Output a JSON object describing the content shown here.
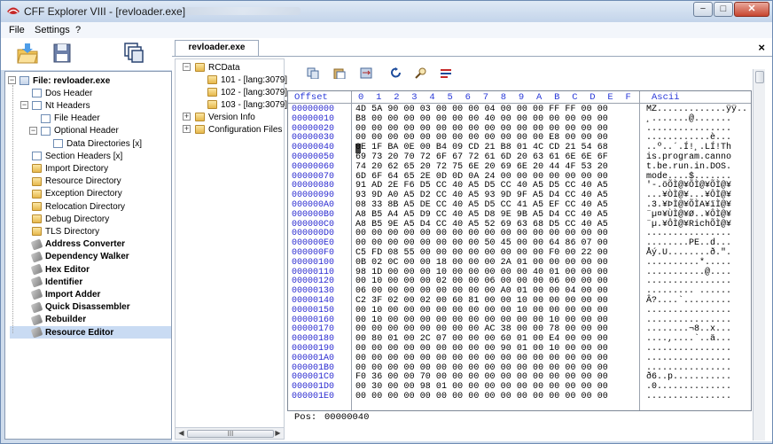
{
  "window": {
    "title": "CFF Explorer VIII - [revloader.exe]",
    "buttons": {
      "minimize": "−",
      "maximize": "□",
      "close": "✕"
    }
  },
  "menu": [
    "File",
    "Settings",
    "?"
  ],
  "left_tree": [
    {
      "label": "File: revloader.exe",
      "bold": true,
      "icon": "doc2",
      "level": 0,
      "expander": "−"
    },
    {
      "label": "Dos Header",
      "icon": "doc",
      "level": 1
    },
    {
      "label": "Nt Headers",
      "icon": "doc",
      "level": 1,
      "expander": "−"
    },
    {
      "label": "File Header",
      "icon": "doc",
      "level": 2
    },
    {
      "label": "Optional Header",
      "icon": "doc",
      "level": 2,
      "expander": "−"
    },
    {
      "label": "Data Directories [x]",
      "icon": "doc",
      "level": 3
    },
    {
      "label": "Section Headers [x]",
      "icon": "doc",
      "level": 1
    },
    {
      "label": "Import Directory",
      "icon": "folder",
      "level": 1
    },
    {
      "label": "Resource Directory",
      "icon": "folder",
      "level": 1
    },
    {
      "label": "Exception Directory",
      "icon": "folder",
      "level": 1
    },
    {
      "label": "Relocation Directory",
      "icon": "folder",
      "level": 1
    },
    {
      "label": "Debug Directory",
      "icon": "folder",
      "level": 1
    },
    {
      "label": "TLS Directory",
      "icon": "folder",
      "level": 1
    },
    {
      "label": "Address Converter",
      "bold": true,
      "icon": "tool",
      "level": 1
    },
    {
      "label": "Dependency Walker",
      "bold": true,
      "icon": "tool",
      "level": 1
    },
    {
      "label": "Hex Editor",
      "bold": true,
      "icon": "tool",
      "level": 1
    },
    {
      "label": "Identifier",
      "bold": true,
      "icon": "tool",
      "level": 1
    },
    {
      "label": "Import Adder",
      "bold": true,
      "icon": "tool",
      "level": 1
    },
    {
      "label": "Quick Disassembler",
      "bold": true,
      "icon": "tool",
      "level": 1
    },
    {
      "label": "Rebuilder",
      "bold": true,
      "icon": "tool",
      "level": 1
    },
    {
      "label": "Resource Editor",
      "bold": true,
      "icon": "tool",
      "level": 1,
      "selected": true
    }
  ],
  "tab": {
    "label": "revloader.exe",
    "close": "×"
  },
  "res_tree": [
    {
      "label": "RCData",
      "level": 0,
      "expander": "−"
    },
    {
      "label": "101 - [lang:3079]",
      "level": 1
    },
    {
      "label": "102 - [lang:3079]",
      "level": 1
    },
    {
      "label": "103 - [lang:3079]",
      "level": 1
    },
    {
      "label": "Version Info",
      "level": 0,
      "expander": "+"
    },
    {
      "label": "Configuration Files",
      "level": 0,
      "expander": "+"
    }
  ],
  "res_scroll": {
    "left": "◀",
    "right": "▶",
    "grip": "III"
  },
  "hex": {
    "header": {
      "offset": "Offset",
      "cols": [
        "0",
        "1",
        "2",
        "3",
        "4",
        "5",
        "6",
        "7",
        "8",
        "9",
        "A",
        "B",
        "C",
        "D",
        "E",
        "F"
      ],
      "ascii": "Ascii"
    },
    "rows": [
      [
        "00000000",
        "4D 5A 90 00 03 00 00 00 04 00 00 00 FF FF 00 00",
        "MZ.............ÿÿ.."
      ],
      [
        "00000010",
        "B8 00 00 00 00 00 00 00 40 00 00 00 00 00 00 00",
        "¸.......@......."
      ],
      [
        "00000020",
        "00 00 00 00 00 00 00 00 00 00 00 00 00 00 00 00",
        "................"
      ],
      [
        "00000030",
        "00 00 00 00 00 00 00 00 00 00 00 00 E8 00 00 00",
        "............è..."
      ],
      [
        "00000040",
        "0E 1F BA 0E 00 B4 09 CD 21 B8 01 4C CD 21 54 68",
        "..º..´.Í!¸.LÍ!Th"
      ],
      [
        "00000050",
        "69 73 20 70 72 6F 67 72 61 6D 20 63 61 6E 6E 6F",
        "is.program.canno"
      ],
      [
        "00000060",
        "74 20 62 65 20 72 75 6E 20 69 6E 20 44 4F 53 20",
        "t.be.run.in.DOS."
      ],
      [
        "00000070",
        "6D 6F 64 65 2E 0D 0D 0A 24 00 00 00 00 00 00 00",
        "mode....$......."
      ],
      [
        "00000080",
        "91 AD 2E F6 D5 CC 40 A5 D5 CC 40 A5 D5 CC 40 A5",
        "'-.öÕÌ@¥ÕÌ@¥ÕÌ@¥"
      ],
      [
        "00000090",
        "93 9D A0 A5 D2 CC 40 A5 93 9D 9F A5 D4 CC 40 A5",
        "...¥ÒÌ@¥...¥ÔÌ@¥"
      ],
      [
        "000000A0",
        "08 33 8B A5 DE CC 40 A5 D5 CC 41 A5 EF CC 40 A5",
        ".3.¥ÞÌ@¥ÕÌA¥ïÌ@¥"
      ],
      [
        "000000B0",
        "A8 B5 A4 A5 D9 CC 40 A5 D8 9E 9B A5 D4 CC 40 A5",
        "¨µ¤¥ÙÌ@¥Ø..¥ÔÌ@¥"
      ],
      [
        "000000C0",
        "A8 B5 9E A5 D4 CC 40 A5 52 69 63 68 D5 CC 40 A5",
        "¨µ.¥ÔÌ@¥RichÕÌ@¥"
      ],
      [
        "000000D0",
        "00 00 00 00 00 00 00 00 00 00 00 00 00 00 00 00",
        "................"
      ],
      [
        "000000E0",
        "00 00 00 00 00 00 00 00 50 45 00 00 64 86 07 00",
        "........PE..d..."
      ],
      [
        "000000F0",
        "C5 FD 08 55 00 00 00 00 00 00 00 00 F0 00 22 00",
        "Åý.U........ð.\"."
      ],
      [
        "00000100",
        "0B 02 0C 00 00 18 00 00 00 2A 01 00 00 00 00 00",
        "..........*....."
      ],
      [
        "00000110",
        "98 1D 00 00 00 10 00 00 00 00 00 40 01 00 00 00",
        "...........@...."
      ],
      [
        "00000120",
        "00 10 00 00 00 02 00 00 06 00 00 00 06 00 00 00",
        "................"
      ],
      [
        "00000130",
        "06 00 00 00 00 00 00 00 00 A0 01 00 00 04 00 00",
        "......... ......"
      ],
      [
        "00000140",
        "C2 3F 02 00 02 00 60 81 00 00 10 00 00 00 00 00",
        "Â?....`........."
      ],
      [
        "00000150",
        "00 10 00 00 00 00 00 00 00 00 10 00 00 00 00 00",
        "................"
      ],
      [
        "00000160",
        "00 10 00 00 00 00 00 00 00 00 00 00 10 00 00 00",
        "................"
      ],
      [
        "00000170",
        "00 00 00 00 00 00 00 00 AC 38 00 00 78 00 00 00",
        "........¬8..x..."
      ],
      [
        "00000180",
        "00 80 01 00 2C 07 00 00 00 60 01 00 E4 00 00 00",
        "....,....`..ä..."
      ],
      [
        "00000190",
        "00 00 00 00 00 00 00 00 00 90 01 00 10 00 00 00",
        "................"
      ],
      [
        "000001A0",
        "00 00 00 00 00 00 00 00 00 00 00 00 00 00 00 00",
        "................"
      ],
      [
        "000001B0",
        "00 00 00 00 00 00 00 00 00 00 00 00 00 00 00 00",
        "................"
      ],
      [
        "000001C0",
        "F0 36 00 00 70 00 00 00 00 00 00 00 00 00 00 00",
        "ð6..p..........."
      ],
      [
        "000001D0",
        "00 30 00 00 98 01 00 00 00 00 00 00 00 00 00 00",
        ".0.............."
      ],
      [
        "000001E0",
        "00 00 00 00 00 00 00 00 00 00 00 00 00 00 00 00",
        "................"
      ]
    ]
  },
  "position": {
    "label": "Pos:",
    "value": "00000040"
  },
  "colors": {
    "offset": "#2a2ad0",
    "header": "#2a3ad8",
    "selection": "#c9dbf3",
    "titlebar": "#c3d4ea"
  }
}
